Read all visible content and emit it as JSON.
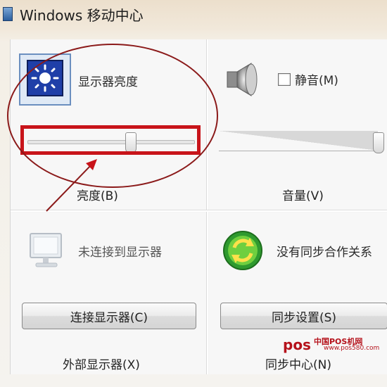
{
  "window": {
    "title": "Windows 移动中心"
  },
  "brightness": {
    "header_label": "显示器亮度",
    "footer_label": "亮度(B)",
    "level": 0.62
  },
  "volume": {
    "mute_label": "静音(M)",
    "mute_checked": false,
    "footer_label": "音量(V)",
    "level": 1.0
  },
  "external_display": {
    "status": "未连接到显示器",
    "button_label": "连接显示器(C)",
    "footer_label": "外部显示器(X)"
  },
  "sync_center": {
    "status": "没有同步合作关系",
    "button_label": "同步设置(S)",
    "footer_label": "同步中心(N)"
  },
  "icons": {
    "brightness": "display-brightness-icon",
    "volume": "speaker-icon",
    "display": "monitor-icon",
    "sync": "sync-icon"
  },
  "watermark": {
    "logo": "pos",
    "text": "中国POS机网",
    "url": "www.pos580.com"
  },
  "colors": {
    "annotation_red": "#c8141a",
    "ellipse": "#8b1a1a"
  }
}
